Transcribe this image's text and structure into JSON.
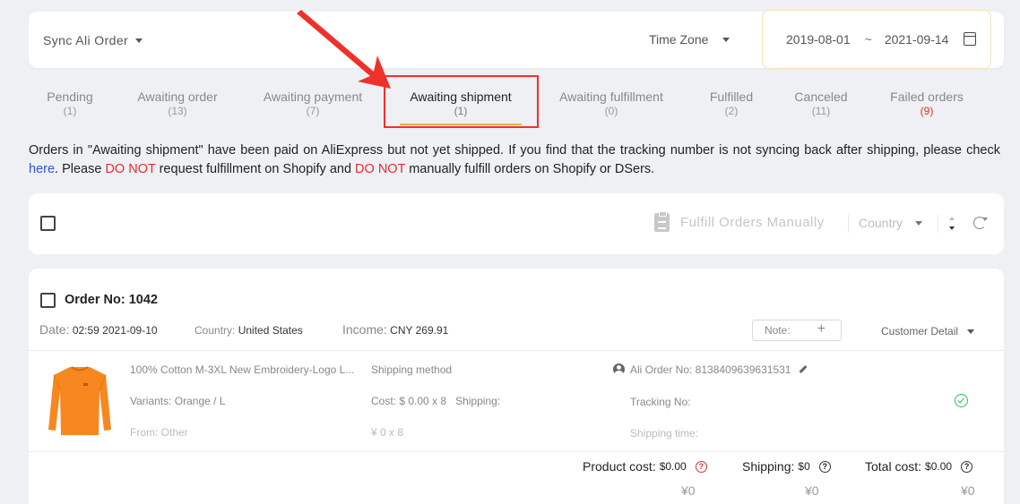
{
  "topbar": {
    "sync_label": "Sync Ali Order",
    "timezone_label": "Time Zone",
    "date_start": "2019-08-01",
    "date_separator": "~",
    "date_end": "2021-09-14"
  },
  "tabs": [
    {
      "label": "Pending",
      "count": "(1)"
    },
    {
      "label": "Awaiting order",
      "count": "(13)"
    },
    {
      "label": "Awaiting payment",
      "count": "(7)"
    },
    {
      "label": "Awaiting shipment",
      "count": "(1)"
    },
    {
      "label": "Awaiting fulfillment",
      "count": "(0)"
    },
    {
      "label": "Fulfilled",
      "count": "(2)"
    },
    {
      "label": "Canceled",
      "count": "(11)"
    },
    {
      "label": "Failed orders",
      "count": "(9)"
    }
  ],
  "active_tab": "Awaiting shipment",
  "notice": {
    "part1": "Orders in \"Awaiting shipment\" have been paid on AliExpress but not yet shipped. If you find that the tracking number is not syncing back after shipping, please check ",
    "link": "here",
    "part2": ". Please ",
    "donot1": "DO NOT",
    "part3": " request fulfillment on Shopify and ",
    "donot2": "DO NOT",
    "part4": " manually fulfill orders on Shopify or DSers."
  },
  "actionbar": {
    "fulfill_label": "Fulfill Orders Manually",
    "country_label": "Country"
  },
  "order": {
    "order_no_label": "Order No: 1042",
    "date_label": "Date:",
    "date_value": "02:59 2021-09-10",
    "country_label": "Country:",
    "country_value": "United States",
    "income_label": "Income:",
    "income_value": "CNY 269.91",
    "note_label": "Note:",
    "note_plus": "+",
    "customer_detail": "Customer Detail",
    "product": {
      "title": "100% Cotton M-3XL New Embroidery-Logo L...",
      "variants": "Variants: Orange / L",
      "from": "From: Other",
      "shipping_method": "Shipping method",
      "cost": "Cost: $ 0.00 x 8",
      "shipping": "Shipping:",
      "cost_cny": "¥ 0 x 8",
      "ali_order_no": "Ali Order No: 8138409639631531",
      "tracking_no": "Tracking No:",
      "shipping_time": "Shipping time:"
    },
    "totals": {
      "product_cost_label": "Product cost:",
      "product_cost_value": "$0.00",
      "shipping_label": "Shipping:",
      "shipping_value": "$0",
      "total_cost_label": "Total cost:",
      "total_cost_value": "$0.00",
      "product_cost_cny": "¥0",
      "shipping_cny": "¥0",
      "total_cost_cny": "¥0"
    }
  },
  "colors": {
    "highlight_red": "#f0302a",
    "link_blue": "#2f55d4",
    "success_green": "#2fba55",
    "shirt_orange": "#f7871f"
  }
}
